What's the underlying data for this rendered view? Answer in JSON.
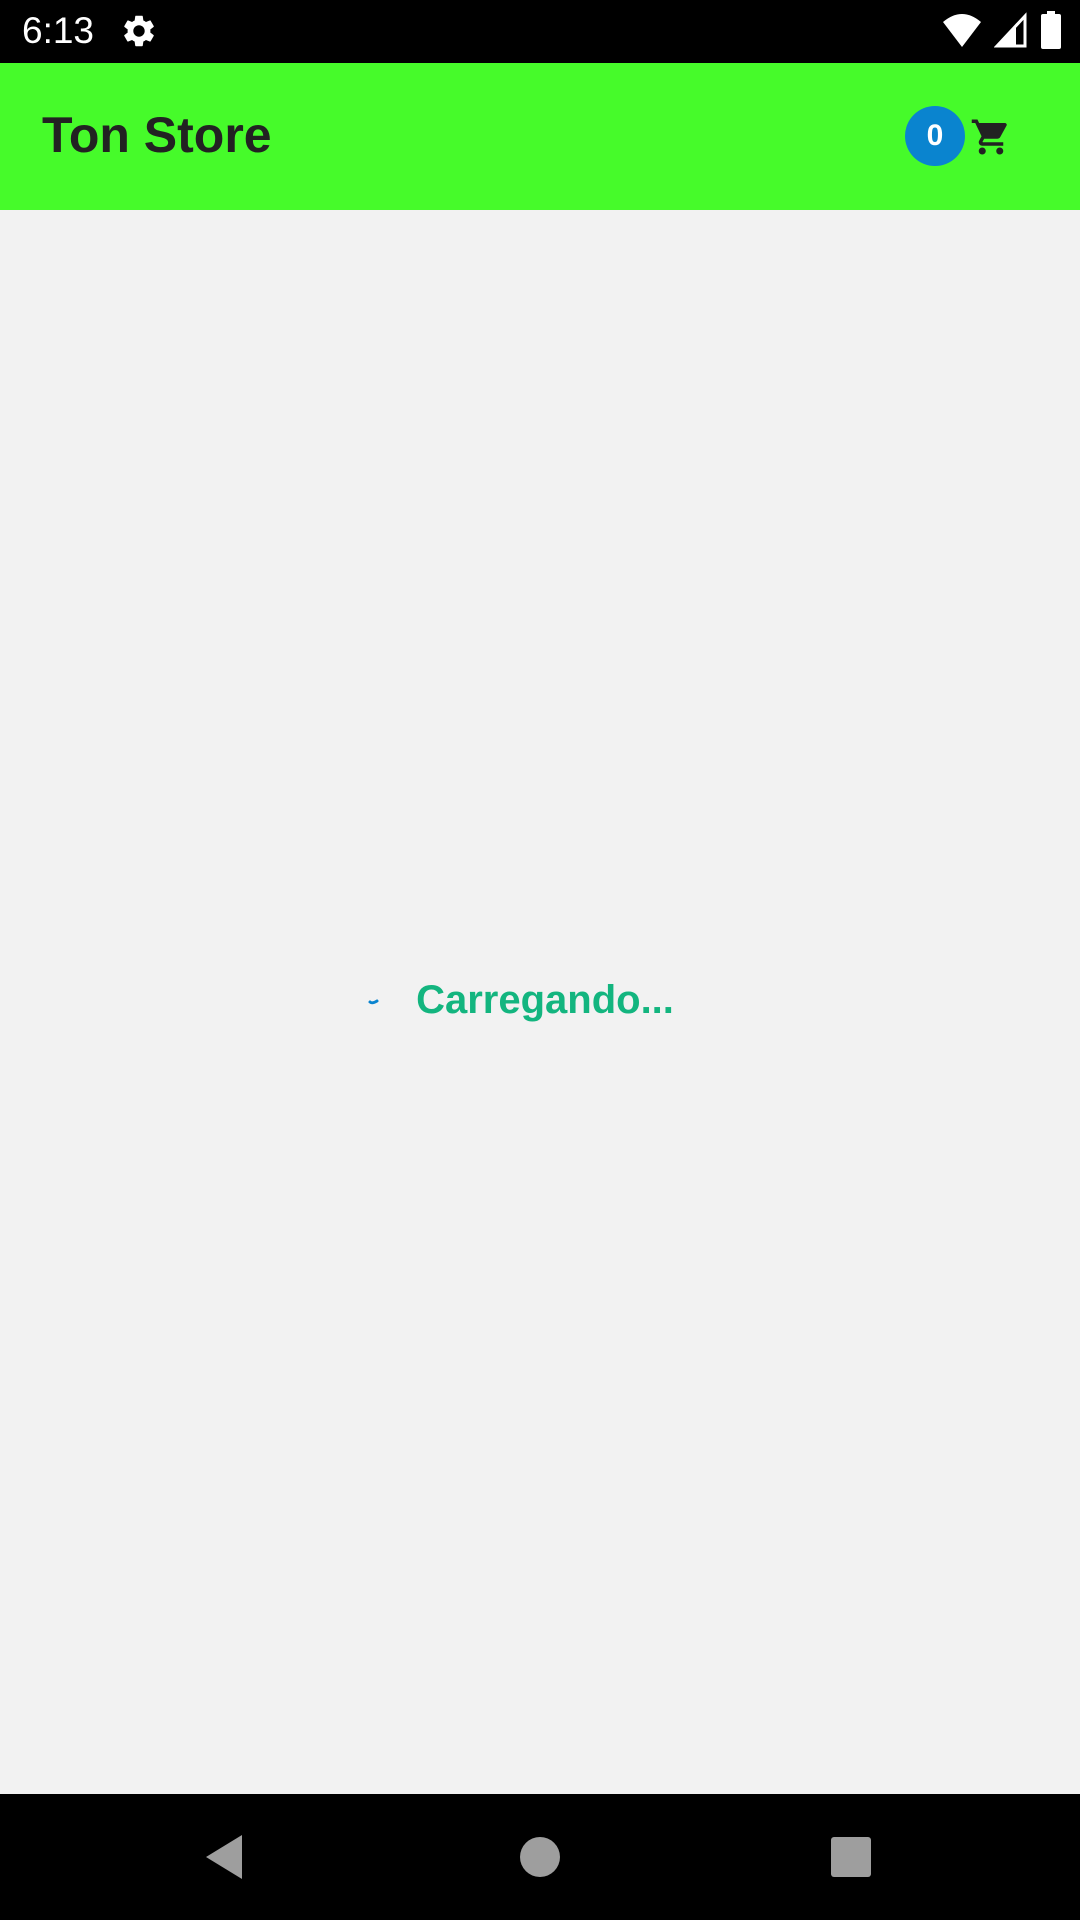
{
  "status_bar": {
    "time": "6:13",
    "icons": [
      "gear-icon",
      "wifi-icon",
      "cell-signal-icon",
      "battery-icon"
    ]
  },
  "app_bar": {
    "title": "Ton Store",
    "cart": {
      "count": "0",
      "icon": "shopping-cart-icon",
      "badge_color": "#0a84cf"
    },
    "background_color": "#46fb2a"
  },
  "main": {
    "loading_text": "Carregando...",
    "loading_color": "#13b57f",
    "spinner_color": "#0a84cf"
  },
  "nav_bar": {
    "buttons": [
      "back-icon",
      "home-icon",
      "recents-icon"
    ]
  }
}
